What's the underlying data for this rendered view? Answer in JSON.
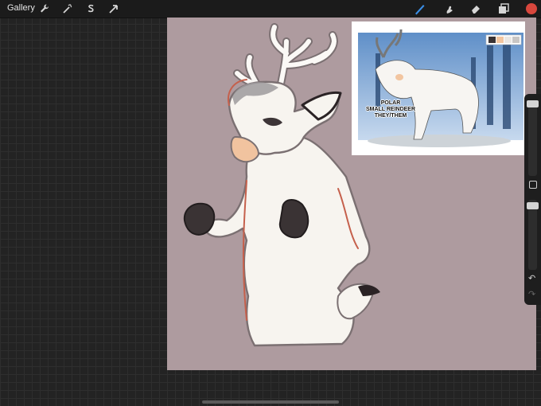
{
  "toolbar": {
    "gallery_label": "Gallery",
    "left_tools": [
      "wrench-icon",
      "magic-wand-icon",
      "selection-s-icon",
      "transform-arrow-icon"
    ],
    "right_tools": [
      "brush-icon",
      "smudge-icon",
      "eraser-icon",
      "layers-icon"
    ],
    "active_tool": "brush-icon",
    "current_color": "#d8473d"
  },
  "canvas": {
    "background_color": "#ae9b9f"
  },
  "reference": {
    "caption_lines": [
      "POLAR",
      "SMALL REINDEER",
      "THEY/THEM"
    ],
    "palette": [
      "#3a3334",
      "#f2c5a0",
      "#ebe7e3",
      "#c9c6c4"
    ]
  },
  "sidebar": {
    "brush_size_level": 0.95,
    "opacity_level": 0.9,
    "undo_icon": "↶",
    "redo_icon": "↷"
  }
}
